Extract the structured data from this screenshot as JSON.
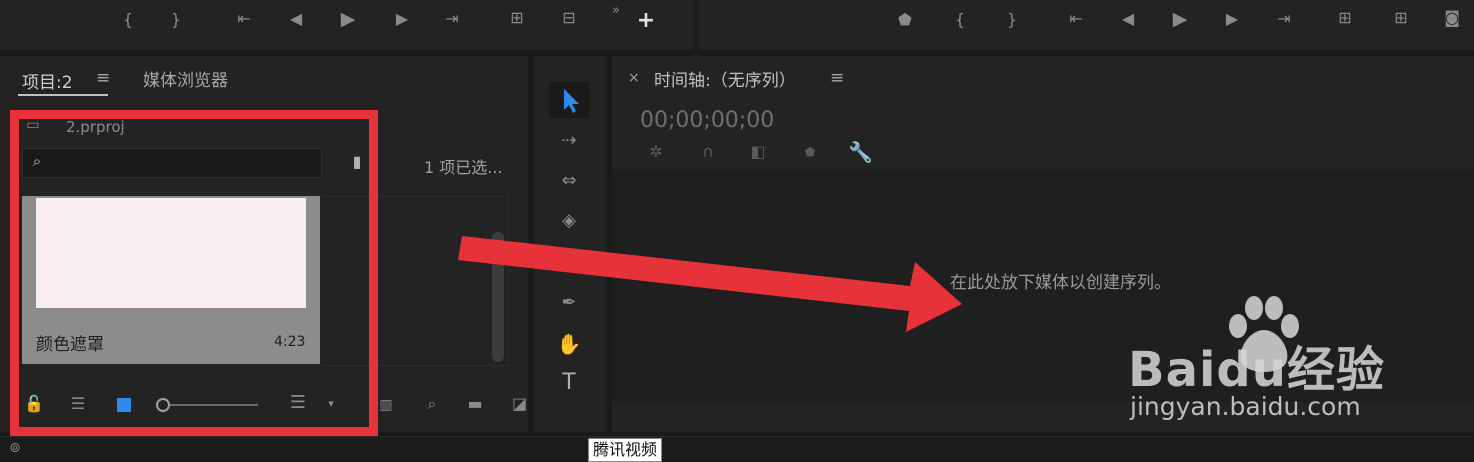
{
  "project_panel": {
    "tab_project": "项目:2",
    "tab_menu": "≡",
    "tab_media": "媒体浏览器",
    "file_name": "2.prproj",
    "selection_status": "1 项已选...",
    "clip_name": "颜色遮罩",
    "clip_duration": "4:23"
  },
  "timeline_panel": {
    "close": "×",
    "title": "时间轴:（无序列）",
    "menu": "≡",
    "timecode": "00;00;00;00",
    "drop_hint": "在此处放下媒体以创建序列。"
  },
  "tools_panel": {
    "type_tool": "T"
  },
  "watermark": {
    "brand": "Baidu经验",
    "url": "jingyan.baidu.com"
  },
  "tooltip": {
    "text": "腾讯视频"
  },
  "colors": {
    "annotation_red": "#e8323a",
    "selection_blue": "#2d8ceb",
    "clip_preview": "#f9eeef",
    "clip_tile": "#8c8c8c"
  },
  "icons": {
    "transport": [
      "mark-in-icon",
      "mark-out-icon",
      "go-to-in-icon",
      "step-back-icon",
      "play-icon",
      "step-forward-icon",
      "go-to-out-icon",
      "insert-icon",
      "overwrite-icon",
      "more-icon",
      "add-icon"
    ],
    "tools": [
      "selection-tool-icon",
      "track-select-tool-icon",
      "ripple-edit-tool-icon",
      "razor-tool-icon",
      "slip-tool-icon",
      "pen-tool-icon",
      "hand-tool-icon",
      "type-tool-icon"
    ]
  }
}
